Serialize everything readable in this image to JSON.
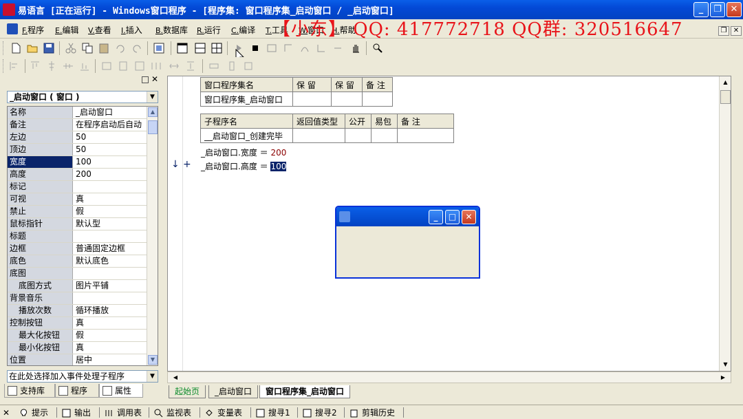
{
  "window": {
    "title": "易语言 [正在运行] - Windows窗口程序 - [程序集: 窗口程序集_启动窗口 / _启动窗口]"
  },
  "menu": {
    "items": [
      {
        "key": "F.",
        "label": "程序"
      },
      {
        "key": "E.",
        "label": "编辑"
      },
      {
        "key": "V.",
        "label": "查看"
      },
      {
        "key": "I.",
        "label": "插入"
      },
      {
        "key": "B.",
        "label": "数据库"
      },
      {
        "key": "R.",
        "label": "运行"
      },
      {
        "key": "C.",
        "label": "编译"
      },
      {
        "key": "T.",
        "label": "工具"
      },
      {
        "key": "W.",
        "label": "窗口"
      },
      {
        "key": "H.",
        "label": "帮助"
      }
    ],
    "overlay": "【小东】   QQ: 417772718   QQ群: 320516647"
  },
  "left_panel": {
    "object_selector": "_启动窗口 ( 窗口 )",
    "properties": [
      {
        "name": "名称",
        "value": "_启动窗口",
        "sub": false
      },
      {
        "name": "备注",
        "value": "在程序启动后自动",
        "sub": false
      },
      {
        "name": "左边",
        "value": "50",
        "sub": false
      },
      {
        "name": "顶边",
        "value": "50",
        "sub": false
      },
      {
        "name": "宽度",
        "value": "100",
        "sub": false,
        "selected": true
      },
      {
        "name": "高度",
        "value": "200",
        "sub": false
      },
      {
        "name": "标记",
        "value": "",
        "sub": false
      },
      {
        "name": "可视",
        "value": "真",
        "sub": false
      },
      {
        "name": "禁止",
        "value": "假",
        "sub": false
      },
      {
        "name": "鼠标指针",
        "value": "默认型",
        "sub": false
      },
      {
        "name": "标题",
        "value": "",
        "sub": false
      },
      {
        "name": "边框",
        "value": "普通固定边框",
        "sub": false
      },
      {
        "name": "底色",
        "value": "默认底色",
        "sub": false
      },
      {
        "name": "底图",
        "value": "",
        "sub": false
      },
      {
        "name": "底图方式",
        "value": "图片平铺",
        "sub": true
      },
      {
        "name": "背景音乐",
        "value": "",
        "sub": false
      },
      {
        "name": "播放次数",
        "value": "循环播放",
        "sub": true
      },
      {
        "name": "控制按钮",
        "value": "真",
        "sub": false
      },
      {
        "name": "最大化按钮",
        "value": "假",
        "sub": true
      },
      {
        "name": "最小化按钮",
        "value": "真",
        "sub": true
      },
      {
        "name": "位置",
        "value": "居中",
        "sub": false
      }
    ],
    "event_selector": "在此处选择加入事件处理子程序",
    "tabs": [
      "支持库",
      "程序",
      "属性"
    ]
  },
  "editor": {
    "assembly_table": {
      "headers": [
        "窗口程序集名",
        "保 留",
        "保 留",
        "备 注"
      ],
      "row": [
        "窗口程序集_启动窗口",
        "",
        "",
        ""
      ]
    },
    "sub_table": {
      "headers": [
        "子程序名",
        "返回值类型",
        "公开",
        "易包",
        "备 注"
      ],
      "row": [
        "__启动窗口_创建完毕",
        "",
        "",
        "",
        ""
      ]
    },
    "code_lines": [
      {
        "target": "_启动窗口.宽度",
        "op": " ＝ ",
        "value": "200",
        "highlight": false
      },
      {
        "target": "_启动窗口.高度",
        "op": " ＝ ",
        "value": "100",
        "highlight": true
      }
    ]
  },
  "doc_tabs": [
    "起始页",
    "_启动窗口",
    "窗口程序集_启动窗口"
  ],
  "bottom_tabs": [
    "提示",
    "输出",
    "调用表",
    "监视表",
    "变量表",
    "搜寻1",
    "搜寻2",
    "剪辑历史"
  ]
}
